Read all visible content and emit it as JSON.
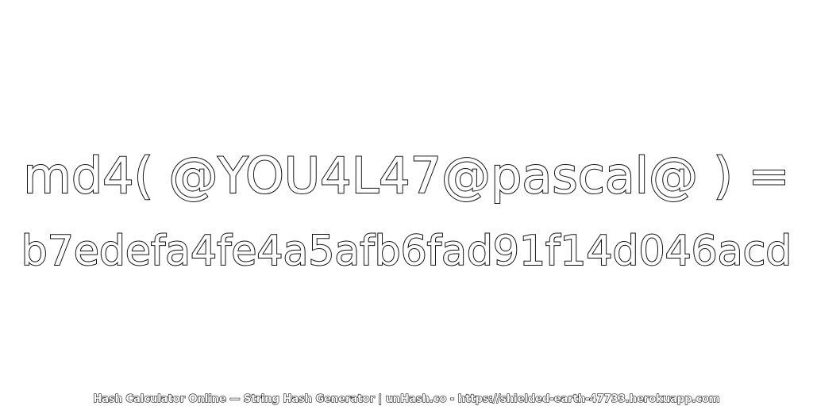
{
  "expression": "md4( @YOU4L47@pascal@ ) =",
  "hash": "b7edefa4fe4a5afb6fad91f14d046acd",
  "footer": "Hash Calculator Online — String Hash Generator | unHash.co - https://shielded-earth-47733.herokuapp.com",
  "colors": {
    "background": "#ffffff",
    "text_fill": "#ffffff",
    "text_outline": "#111111"
  }
}
